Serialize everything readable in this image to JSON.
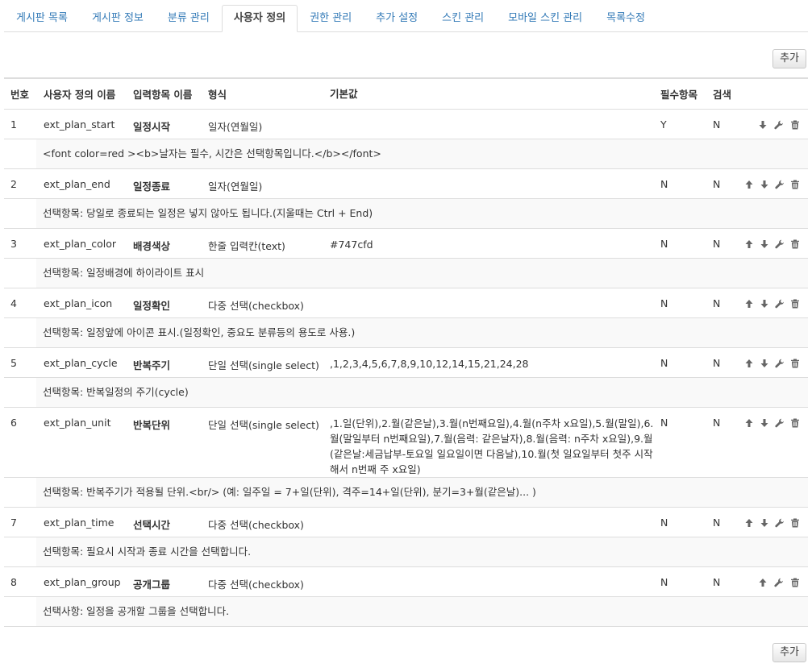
{
  "tabs": [
    {
      "label": "게시판 목록"
    },
    {
      "label": "게시판 정보"
    },
    {
      "label": "분류 관리"
    },
    {
      "label": "사용자 정의",
      "active": true
    },
    {
      "label": "권한 관리"
    },
    {
      "label": "추가 설정"
    },
    {
      "label": "스킨 관리"
    },
    {
      "label": "모바일 스킨 관리"
    },
    {
      "label": "목록수정"
    }
  ],
  "toolbar": {
    "add_label": "추가"
  },
  "columns": {
    "no": "번호",
    "id": "사용자 정의 이름",
    "name": "입력항목 이름",
    "type": "형식",
    "default": "기본값",
    "required": "필수항목",
    "search": "검색"
  },
  "rows": [
    {
      "no": "1",
      "id": "ext_plan_start",
      "name": "일정시작",
      "type": "일자(연월일)",
      "default": "",
      "required": "Y",
      "search": "N",
      "desc": "<font color=red ><b>날자는 필수, 시간은 선택항목입니다.</b></font>",
      "actions": [
        "down",
        "edit",
        "delete"
      ]
    },
    {
      "no": "2",
      "id": "ext_plan_end",
      "name": "일정종료",
      "type": "일자(연월일)",
      "default": "",
      "required": "N",
      "search": "N",
      "desc": "선택항목: 당일로 종료되는 일정은 넣지 않아도 됩니다.(지울때는 Ctrl + End)",
      "actions": [
        "up",
        "down",
        "edit",
        "delete"
      ]
    },
    {
      "no": "3",
      "id": "ext_plan_color",
      "name": "배경색상",
      "type": "한줄 입력칸(text)",
      "default": "#747cfd",
      "required": "N",
      "search": "N",
      "desc": "선택항목: 일정배경에 하이라이트 표시",
      "actions": [
        "up",
        "down",
        "edit",
        "delete"
      ]
    },
    {
      "no": "4",
      "id": "ext_plan_icon",
      "name": "일정확인",
      "type": "다중 선택(checkbox)",
      "default": "",
      "required": "N",
      "search": "N",
      "desc": "선택항목: 일정앞에 아이콘 표시.(일정확인, 중요도 분류등의 용도로 사용.)",
      "actions": [
        "up",
        "down",
        "edit",
        "delete"
      ]
    },
    {
      "no": "5",
      "id": "ext_plan_cycle",
      "name": "반복주기",
      "type": "단일 선택(single select)",
      "default": ",1,2,3,4,5,6,7,8,9,10,12,14,15,21,24,28",
      "required": "N",
      "search": "N",
      "desc": "선택항목: 반복일정의 주기(cycle)",
      "actions": [
        "up",
        "down",
        "edit",
        "delete"
      ]
    },
    {
      "no": "6",
      "id": "ext_plan_unit",
      "name": "반복단위",
      "type": "단일 선택(single select)",
      "default": ",1.일(단위),2.월(같은날),3.월(n번째요일),4.월(n주차 x요일),5.월(말일),6.월(말일부터 n번째요일),7.월(음력: 같은날자),8.월(음력: n주차 x요일),9.월(같은날:세금납부-토요일 일요일이면 다음날),10.월(첫 일요일부터 첫주 시작해서 n번째 주 x요일)",
      "required": "N",
      "search": "N",
      "desc": "선택항목: 반복주기가 적용될 단위.<br/> (예: 일주일 = 7+일(단위), 격주=14+일(단위), 분기=3+월(같은날)... )",
      "actions": [
        "up",
        "down",
        "edit",
        "delete"
      ]
    },
    {
      "no": "7",
      "id": "ext_plan_time",
      "name": "선택시간",
      "type": "다중 선택(checkbox)",
      "default": "",
      "required": "N",
      "search": "N",
      "desc": "선택항목: 필요시 시작과 종료 시간을 선택합니다.",
      "actions": [
        "up",
        "down",
        "edit",
        "delete"
      ]
    },
    {
      "no": "8",
      "id": "ext_plan_group",
      "name": "공개그룹",
      "type": "다중 선택(checkbox)",
      "default": "",
      "required": "N",
      "search": "N",
      "desc": "선택사항: 일정을 공개할 그룹을 선택합니다.",
      "actions": [
        "up",
        "edit",
        "delete"
      ]
    }
  ],
  "icons": {
    "up": "arrow-up-icon",
    "down": "arrow-down-icon",
    "edit": "wrench-icon",
    "delete": "trash-icon"
  }
}
